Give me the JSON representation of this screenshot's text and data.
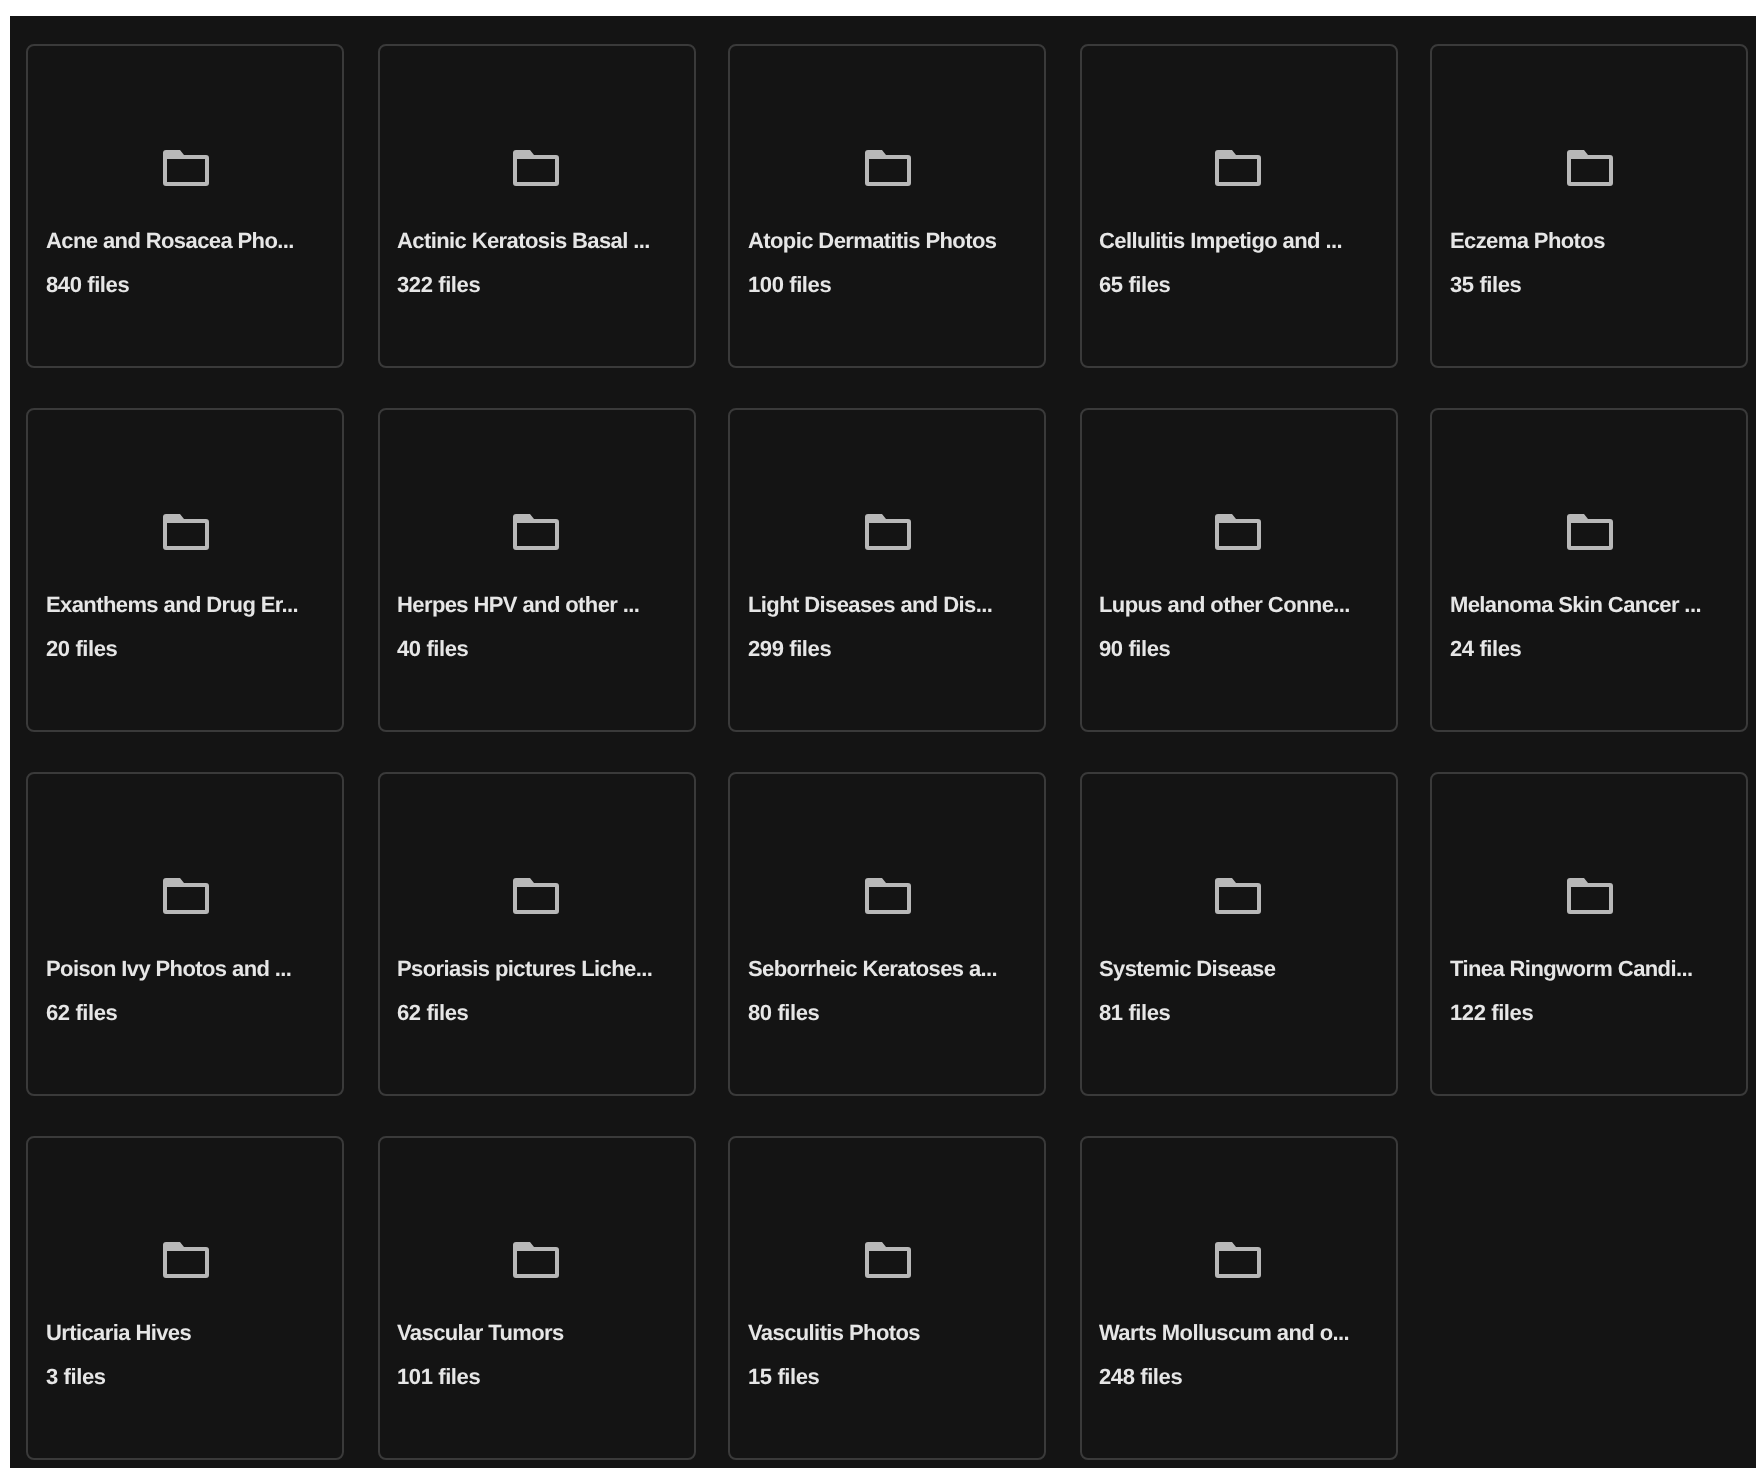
{
  "folders": [
    {
      "name": "Acne and Rosacea Pho...",
      "count": "840 files"
    },
    {
      "name": "Actinic Keratosis Basal ...",
      "count": "322 files"
    },
    {
      "name": "Atopic Dermatitis Photos",
      "count": "100 files"
    },
    {
      "name": "Cellulitis Impetigo and ...",
      "count": "65 files"
    },
    {
      "name": "Eczema Photos",
      "count": "35 files"
    },
    {
      "name": "Exanthems and Drug Er...",
      "count": "20 files"
    },
    {
      "name": "Herpes HPV and other ...",
      "count": "40 files"
    },
    {
      "name": "Light Diseases and Dis...",
      "count": "299 files"
    },
    {
      "name": "Lupus and other Conne...",
      "count": "90 files"
    },
    {
      "name": "Melanoma Skin Cancer ...",
      "count": "24 files"
    },
    {
      "name": "Poison Ivy Photos and ...",
      "count": "62 files"
    },
    {
      "name": "Psoriasis pictures Liche...",
      "count": "62 files"
    },
    {
      "name": "Seborrheic Keratoses a...",
      "count": "80 files"
    },
    {
      "name": "Systemic Disease",
      "count": "81 files"
    },
    {
      "name": "Tinea Ringworm Candi...",
      "count": "122 files"
    },
    {
      "name": "Urticaria Hives",
      "count": "3 files"
    },
    {
      "name": "Vascular Tumors",
      "count": "101 files"
    },
    {
      "name": "Vasculitis Photos",
      "count": "15 files"
    },
    {
      "name": "Warts Molluscum and o...",
      "count": "248 files"
    }
  ]
}
